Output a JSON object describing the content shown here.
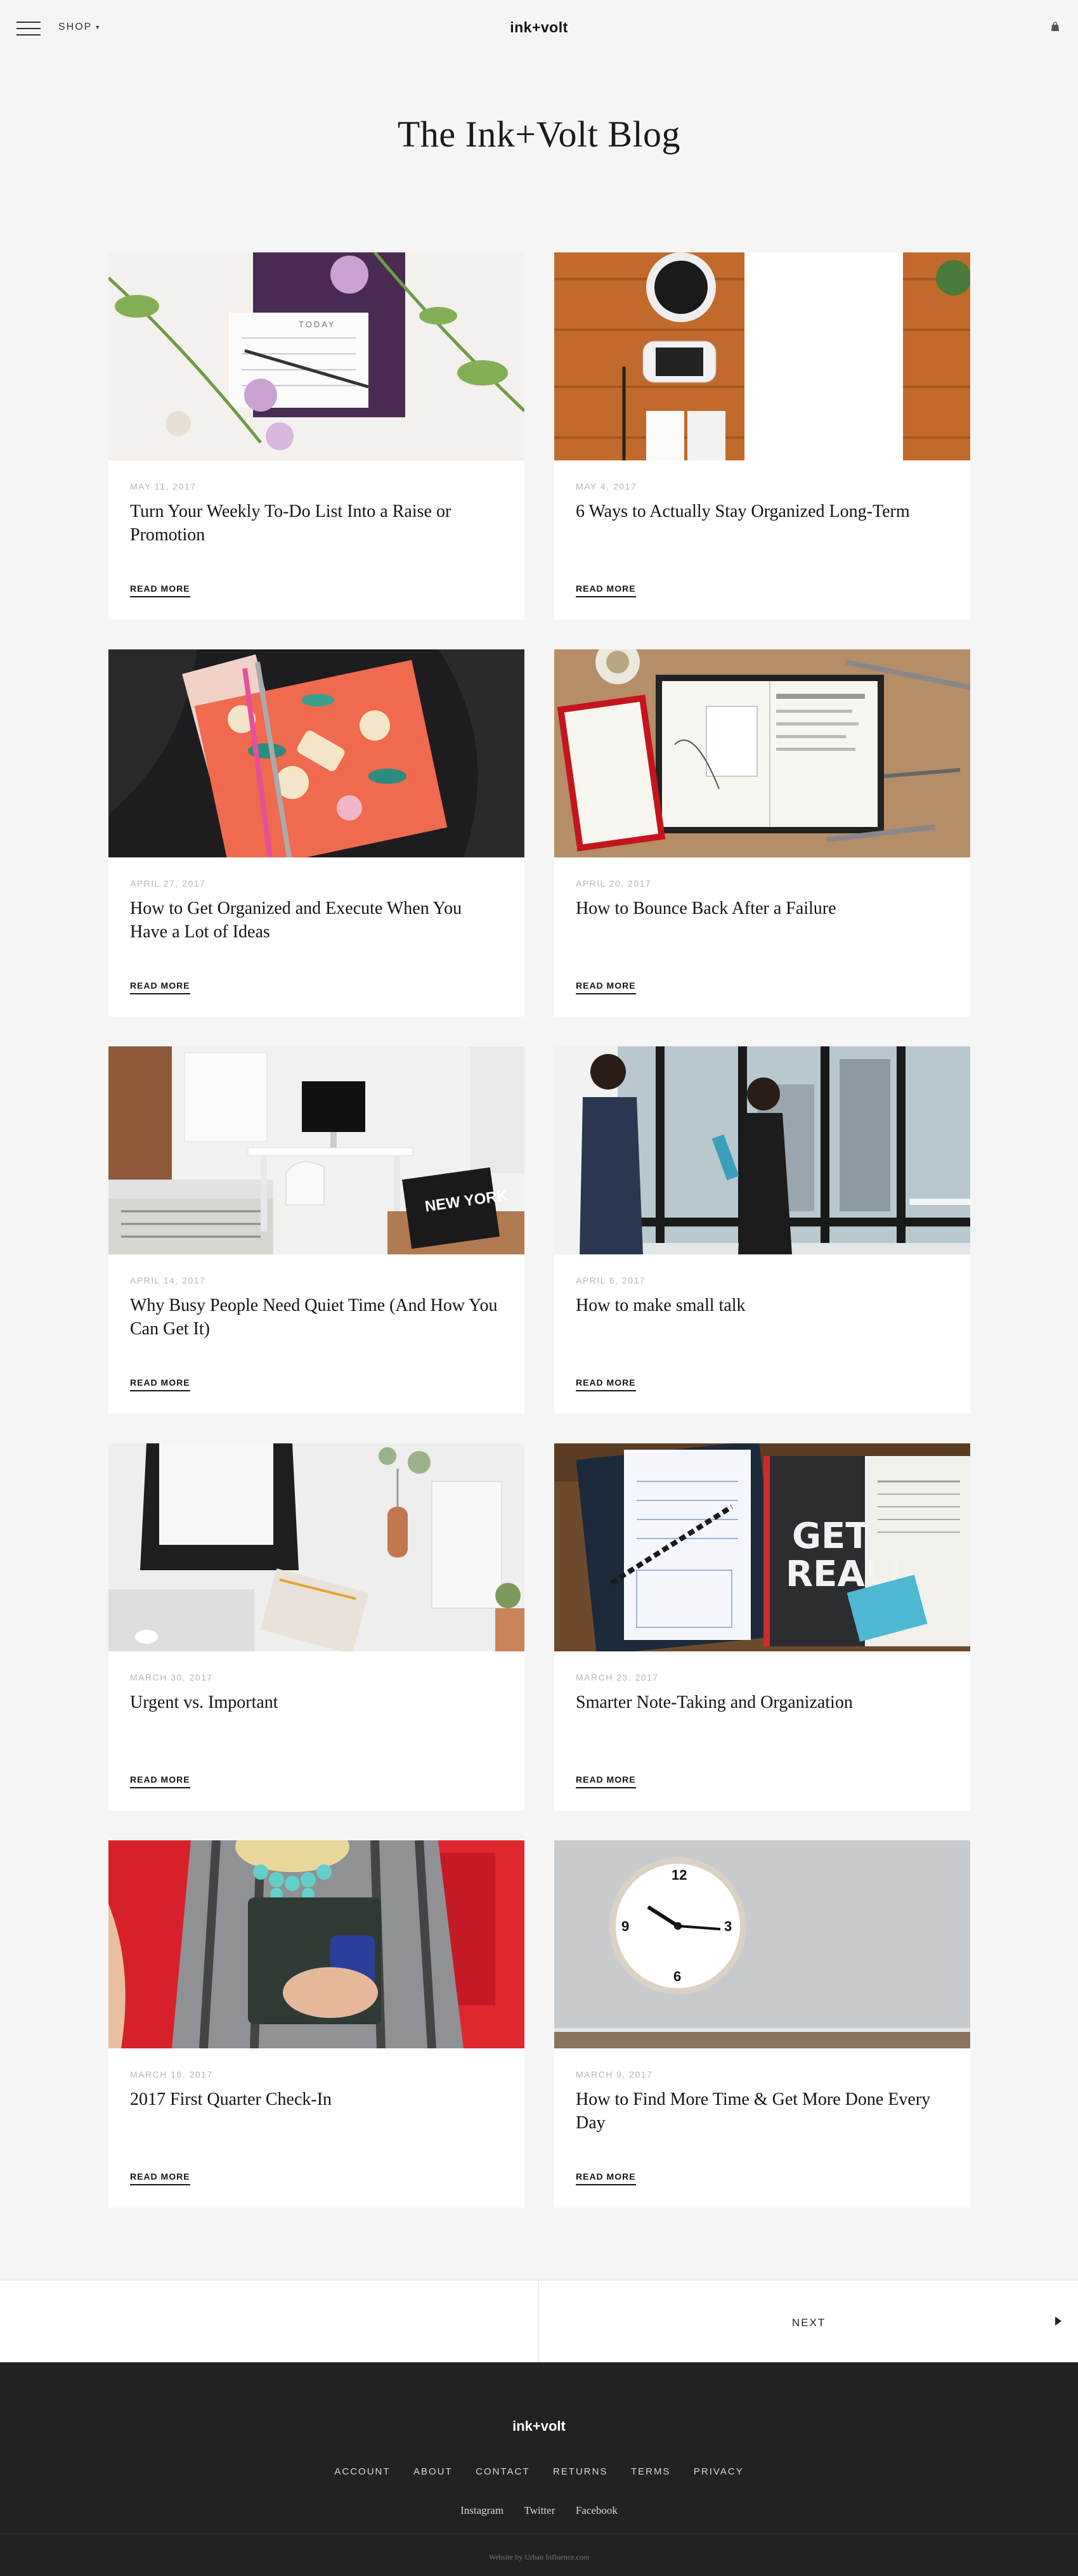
{
  "header": {
    "shop_label": "SHOP",
    "logo_text": "ink+volt",
    "menu_icon": "hamburger-menu-icon",
    "bag_icon": "shopping-bag-icon"
  },
  "page": {
    "title": "The Ink+Volt Blog"
  },
  "posts": [
    {
      "date": "MAY 11, 2017",
      "title": "Turn Your Weekly To-Do List Into a Raise or Promotion",
      "read_more": "READ MORE",
      "image": "planner-with-flowers"
    },
    {
      "date": "MAY 4, 2017",
      "title": "6 Ways to Actually Stay Organized Long-Term",
      "read_more": "READ MORE",
      "image": "coffee-phone-desk"
    },
    {
      "date": "APRIL 27, 2017",
      "title": "How to Get Organized and Execute When You Have a Lot of Ideas",
      "read_more": "READ MORE",
      "image": "floral-notebook-bag"
    },
    {
      "date": "APRIL 20, 2017",
      "title": "How to Bounce Back After a Failure",
      "read_more": "READ MORE",
      "image": "open-planner-tools"
    },
    {
      "date": "APRIL 14, 2017",
      "title": "Why Busy People Need Quiet Time (And How You Can Get It)",
      "read_more": "READ MORE",
      "image": "bedroom-workspace"
    },
    {
      "date": "APRIL 6, 2017",
      "title": "How to make small talk",
      "read_more": "READ MORE",
      "image": "people-talking-window"
    },
    {
      "date": "MARCH 30, 2017",
      "title": "Urgent vs. Important",
      "read_more": "READ MORE",
      "image": "white-desk-laptop"
    },
    {
      "date": "MARCH 23, 2017",
      "title": "Smarter Note-Taking and Organization",
      "read_more": "READ MORE",
      "image": "notepad-get-real-book"
    },
    {
      "date": "MARCH 16, 2017",
      "title": "2017 First Quarter Check-In",
      "read_more": "READ MORE",
      "image": "woman-holding-planner"
    },
    {
      "date": "MARCH 9, 2017",
      "title": "How to Find More Time & Get More Done Every Day",
      "read_more": "READ MORE",
      "image": "wall-clock"
    }
  ],
  "pagination": {
    "next_label": "NEXT"
  },
  "footer": {
    "logo_text": "ink+volt",
    "links": [
      "ACCOUNT",
      "ABOUT",
      "CONTACT",
      "RETURNS",
      "TERMS",
      "PRIVACY"
    ],
    "social": [
      "Instagram",
      "Twitter",
      "Facebook"
    ],
    "credit": "Website by Urban Influence.com"
  },
  "colors": {
    "page_bg": "#f5f5f5",
    "card_bg": "#ffffff",
    "footer_bg": "#222222",
    "date_text": "#b5b5b5"
  }
}
